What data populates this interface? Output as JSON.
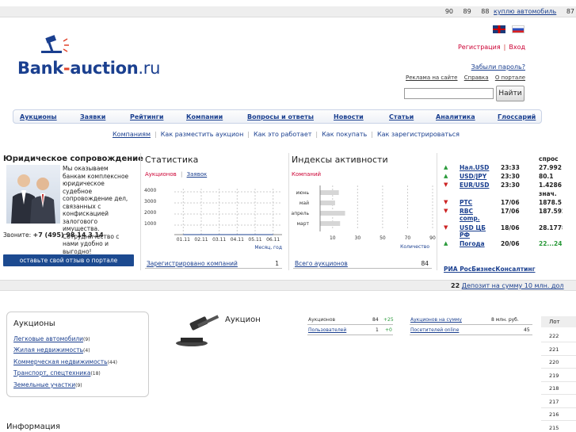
{
  "ticker": {
    "items": [
      "90",
      "89",
      "88"
    ],
    "link": "куплю автомобиль",
    "last": "87"
  },
  "logo": {
    "part1": "Bank",
    "part2": "-",
    "part3": "auction",
    "part4": ".ru"
  },
  "auth": {
    "register": "Регистрация",
    "login": "Вход",
    "forgot": "Забыли пароль?"
  },
  "toplinks": [
    "Реклама на сайте",
    "Справка",
    "О портале"
  ],
  "search": {
    "value": "",
    "button": "Найти"
  },
  "nav": [
    "Аукционы",
    "Заявки",
    "Рейтинги",
    "Компании",
    "Вопросы и ответы",
    "Новости",
    "Статьи",
    "Аналитика",
    "Глоссарий"
  ],
  "subnav": [
    "Компаниям",
    "Как разместить аукцион",
    "Как это работает",
    "Как покупать",
    "Как зарегистрироваться"
  ],
  "legal": {
    "title": "Юридическое сопровождение",
    "text": "Мы оказываем банкам комплексное юридическое судебное сопровождение дел, связанных с конфискацией залогового имущества. Сотрудничество с нами удобно и выгодно!",
    "phone_label": "Звоните:",
    "phone": "+7 (495) 98 14 3 14",
    "feedback": "оставьте свой отзыв о портале"
  },
  "stats": {
    "title": "Статистика",
    "tab_active": "Аукционов",
    "tab_other": "Заявок",
    "summary_label": "Зарегистрировано компаний",
    "summary_value": "1",
    "y_ticks": [
      "4000",
      "3000",
      "2000",
      "1000"
    ],
    "xlabel": "Месяц, год"
  },
  "activity": {
    "title": "Индексы активности",
    "tab": "Компаний",
    "summary_label": "Всего аукционов",
    "summary_value": "84",
    "x_ticks": [
      "10",
      "30",
      "50",
      "70",
      "90"
    ],
    "xlabel": "Количество"
  },
  "chart_data": [
    {
      "type": "line",
      "title": "Статистика",
      "x": [
        "01.11",
        "02.11",
        "03.11",
        "04.11",
        "05.11",
        "06.11"
      ],
      "ylim": [
        0,
        4000
      ],
      "yticks": [
        1000,
        2000,
        3000,
        4000
      ],
      "xlabel": "Месяц, год",
      "series": [
        {
          "values": [
            0,
            0,
            0,
            0,
            0,
            0
          ]
        }
      ],
      "grid": true
    },
    {
      "type": "bar",
      "title": "Индексы активности",
      "orientation": "horizontal",
      "categories": [
        "июнь",
        "май",
        "апрель",
        "март"
      ],
      "values": [
        15,
        12,
        20,
        16
      ],
      "xlim": [
        0,
        90
      ],
      "xticks": [
        10,
        30,
        50,
        70,
        90
      ],
      "xlabel": "Количество",
      "grid": true
    }
  ],
  "currency": {
    "header": "спрос",
    "rows": [
      {
        "dir": "up",
        "name": "Нал.USD",
        "time": "23:33",
        "value": "27.992"
      },
      {
        "dir": "up",
        "name": "USD/JPY",
        "time": "23:30",
        "value": "80.1"
      },
      {
        "dir": "down",
        "name": "EUR/USD",
        "time": "23:30",
        "value": "1.4286"
      },
      {
        "dir": "none",
        "name": "",
        "time": "",
        "value": "знач."
      },
      {
        "dir": "down",
        "name": "РТС",
        "time": "17/06",
        "value": "1878.5"
      },
      {
        "dir": "down",
        "name": "RBC comp.",
        "time": "17/06",
        "value": "187.592"
      },
      {
        "dir": "down",
        "name": "USD ЦБ РФ",
        "time": "18/06",
        "value": "28.1778"
      },
      {
        "dir": "up",
        "name": "Погода",
        "time": "20/06",
        "value": "22...24"
      }
    ],
    "source": "РИА РосБизнесКонсалтинг"
  },
  "ticker2": {
    "num": "22",
    "text": "Депозит на сумму 10 млн. дол"
  },
  "auctions_box": {
    "title": "Аукционы",
    "items": [
      {
        "label": "Легковые автомобили",
        "count": "(9)"
      },
      {
        "label": "Жилая недвижимость",
        "count": "(4)"
      },
      {
        "label": "Коммерческая недвижимость",
        "count": "(44)"
      },
      {
        "label": "Транспорт, спецтехника",
        "count": "(18)"
      },
      {
        "label": "Земельные участки",
        "count": "(9)"
      }
    ]
  },
  "info_title": "Информация",
  "auction_block": {
    "label": "Аукцион",
    "rows_left": [
      {
        "label": "Аукционов",
        "v1": "84",
        "v2": "+25"
      },
      {
        "label": "Пользователей",
        "v1": "1",
        "v2": "+0"
      }
    ],
    "rows_right": [
      {
        "label": "Аукционов на сумму",
        "v1": "8 млн. руб."
      },
      {
        "label": "Посетителей online",
        "v1": "45"
      }
    ]
  },
  "lots": {
    "header": "Лот",
    "items": [
      "222",
      "221",
      "220",
      "219",
      "218",
      "217",
      "216",
      "215"
    ]
  }
}
